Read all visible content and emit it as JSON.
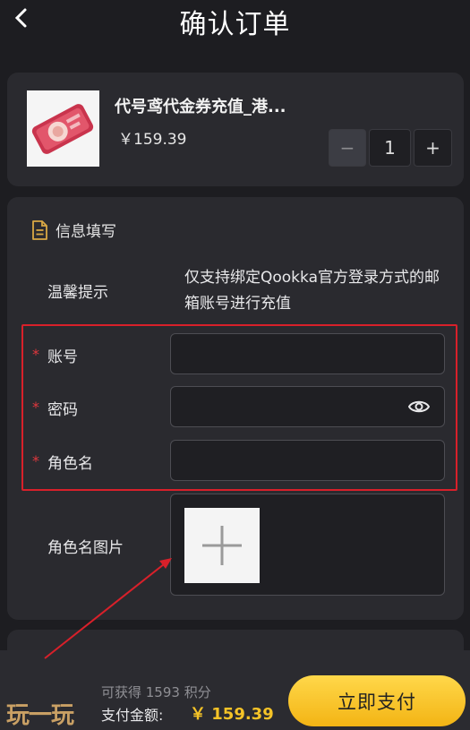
{
  "header": {
    "title": "确认订单",
    "back_icon": "chevron-left-icon"
  },
  "product": {
    "name": "代号鸢代金券充值_港...",
    "price": "￥159.39",
    "quantity": "1",
    "minus_label": "−",
    "plus_label": "+"
  },
  "form": {
    "section_title": "信息填写",
    "section_icon": "document-icon",
    "tip_label": "温馨提示",
    "tip_text": "仅支持绑定Qookka官方登录方式的邮箱账号进行充值",
    "required_mark": "*",
    "fields": [
      {
        "label": "账号",
        "value": ""
      },
      {
        "label": "密码",
        "value": ""
      },
      {
        "label": "角色名",
        "value": ""
      }
    ],
    "upload_label": "角色名图片",
    "highlight_color": "#d8202a"
  },
  "footer": {
    "points": "可获得 1593 积分",
    "total_label": "支付金额:",
    "total_value": "￥ 159.39",
    "pay_button": "立即支付",
    "accent": "#f5c327"
  },
  "watermark": {
    "text": "玩一玩"
  }
}
